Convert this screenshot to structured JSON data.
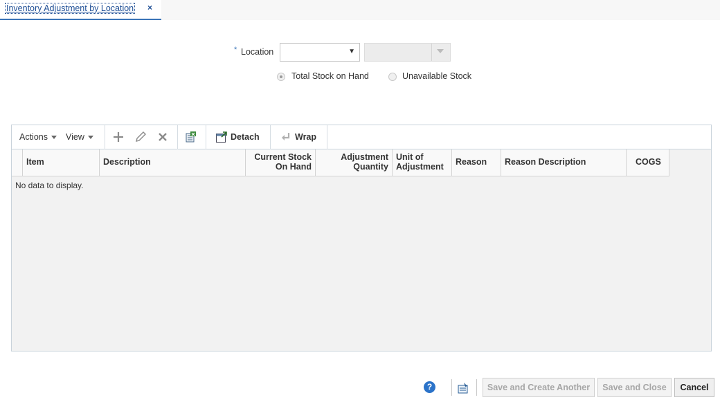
{
  "tab": {
    "title": "Inventory Adjustment by Location",
    "close": "×"
  },
  "form": {
    "required_mark": "*",
    "location_label": "Location",
    "location_value": "",
    "location_desc_value": "",
    "radio_total": "Total Stock on Hand",
    "radio_unavailable": "Unavailable Stock",
    "selected_radio": "total"
  },
  "toolbar": {
    "actions": "Actions",
    "view": "View",
    "detach": "Detach",
    "wrap": "Wrap"
  },
  "table": {
    "columns": [
      "Item",
      "Description",
      "Current Stock On Hand",
      "Adjustment Quantity",
      "Unit of Adjustment",
      "Reason",
      "Reason Description",
      "COGS"
    ],
    "col_line1": [
      "Item",
      "Description",
      "Current Stock",
      "Adjustment",
      "Unit of",
      "Reason",
      "Reason Description",
      "COGS"
    ],
    "col_line2": [
      "",
      "",
      "On Hand",
      "Quantity",
      "Adjustment",
      "",
      "",
      ""
    ],
    "empty_text": "No data to display."
  },
  "footer": {
    "help": "?",
    "save_create_another": "Save and Create Another",
    "save_close": "Save and Close",
    "cancel": "Cancel"
  },
  "colors": {
    "accent": "#3a74b8",
    "link": "#1f4f96",
    "help": "#2b73c9"
  }
}
